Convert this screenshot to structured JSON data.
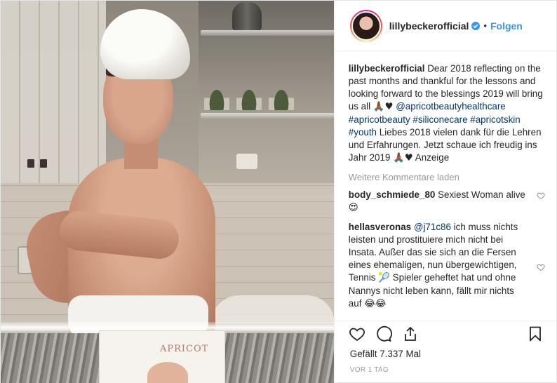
{
  "post": {
    "username": "lillybeckerofficial",
    "verified_icon": "verified-badge-icon",
    "separator": "•",
    "follow_label": "Folgen",
    "caption": {
      "author": "lillybeckerofficial",
      "part1": "Dear 2018 reflecting on the past months and thankful for the lessons and looking forward to the blessings 2019 will bring us all",
      "emoji1": "🙏🏾♥",
      "tags": [
        "@apricotbeautyhealthcare",
        "#apricotbeauty",
        "#siliconecare",
        "#apricotskin",
        "#youth"
      ],
      "part2": "Liebes 2018 vielen dank für die Lehren und Erfahrungen. Jetzt schaue ich freudig ins Jahr 2019",
      "emoji2": "🙏🏾♥",
      "part3": "Anzeige"
    },
    "load_more": "Weitere Kommentare laden",
    "comments": [
      {
        "user": "body_schmiede_80",
        "text": "Sexiest Woman alive",
        "emoji": "😍"
      },
      {
        "user": "hellasveronas",
        "mention": "@j71c86",
        "text": "ich muss nichts leisten und prostituiere mich nicht bei Insata. Außer das sie sich an die Fersen eines ehemaligen, nun übergewichtigen, Tennis",
        "emoji_mid": "🎾",
        "text2": "Spieler geheftet hat und ohne Nannys nicht leben kann, fällt mir nichts auf",
        "emoji_end": "😂😂"
      }
    ],
    "likes": "Gefällt 7.337 Mal",
    "timestamp": "VOR 1 TAG",
    "photo_box_brand": "APRICOT",
    "colors": {
      "link": "#003569",
      "follow": "#3897f0",
      "muted": "#999999",
      "text": "#262626"
    }
  }
}
